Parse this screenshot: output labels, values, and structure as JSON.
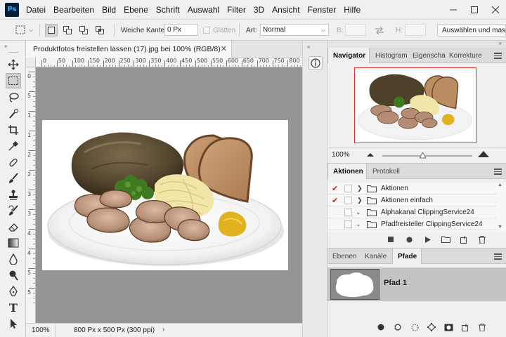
{
  "app": {
    "logo": "Ps",
    "menu": [
      "Datei",
      "Bearbeiten",
      "Bild",
      "Ebene",
      "Schrift",
      "Auswahl",
      "Filter",
      "3D",
      "Ansicht",
      "Fenster",
      "Hilfe"
    ]
  },
  "options": {
    "feather_label": "Weiche Kante:",
    "feather_value": "0 Px",
    "antialias_label": "Glätten",
    "style_label": "Art:",
    "style_value": "Normal",
    "width_label": "B:",
    "height_label": "H:",
    "select_mask_button": "Auswählen und mask"
  },
  "document": {
    "tab_title": "Produktfotos freistellen lassen (17).jpg bei 100% (RGB/8)",
    "ruler_h_labels": [
      "0",
      "50",
      "100",
      "150",
      "200",
      "250",
      "300",
      "350",
      "400",
      "450",
      "500",
      "550",
      "600",
      "650",
      "700",
      "750",
      "800"
    ],
    "ruler_v_labels": [
      "0",
      "5",
      "1",
      "1",
      "2",
      "2",
      "3",
      "3",
      "4",
      "4",
      "5",
      "5"
    ],
    "zoom": "100%",
    "size_info": "800 Px x 500 Px (300 ppi)"
  },
  "navigator": {
    "tabs": [
      "Navigator",
      "Histogram",
      "Eigenschaf",
      "Korrekture"
    ],
    "zoom": "100%",
    "zoom_fraction": 0.45
  },
  "actions": {
    "tabs": [
      "Aktionen",
      "Protokoll"
    ],
    "items": [
      {
        "label": "Aktionen",
        "checked": true,
        "expanded": false
      },
      {
        "label": "Aktionen einfach",
        "checked": true,
        "expanded": false
      },
      {
        "label": "Alphakanal ClippingService24",
        "checked": false,
        "expanded": true
      },
      {
        "label": "Pfadfreisteller ClippingService24",
        "checked": false,
        "expanded": true
      }
    ]
  },
  "layers": {
    "tabs": [
      "Ebenen",
      "Kanäle",
      "Pfade"
    ],
    "path_name": "Pfad 1"
  },
  "colors": {
    "accent_check": "#d12020",
    "nav_viewbox": "#e03030",
    "canvas_bg": "#959595"
  },
  "icons": {
    "tools": [
      "move-icon",
      "marquee-icon",
      "lasso-icon",
      "quick-select-icon",
      "crop-icon",
      "eyedropper-icon",
      "healing-brush-icon",
      "brush-icon",
      "clone-stamp-icon",
      "history-brush-icon",
      "eraser-icon",
      "gradient-icon",
      "blur-icon",
      "dodge-icon",
      "pen-icon",
      "type-icon",
      "path-select-icon"
    ]
  }
}
